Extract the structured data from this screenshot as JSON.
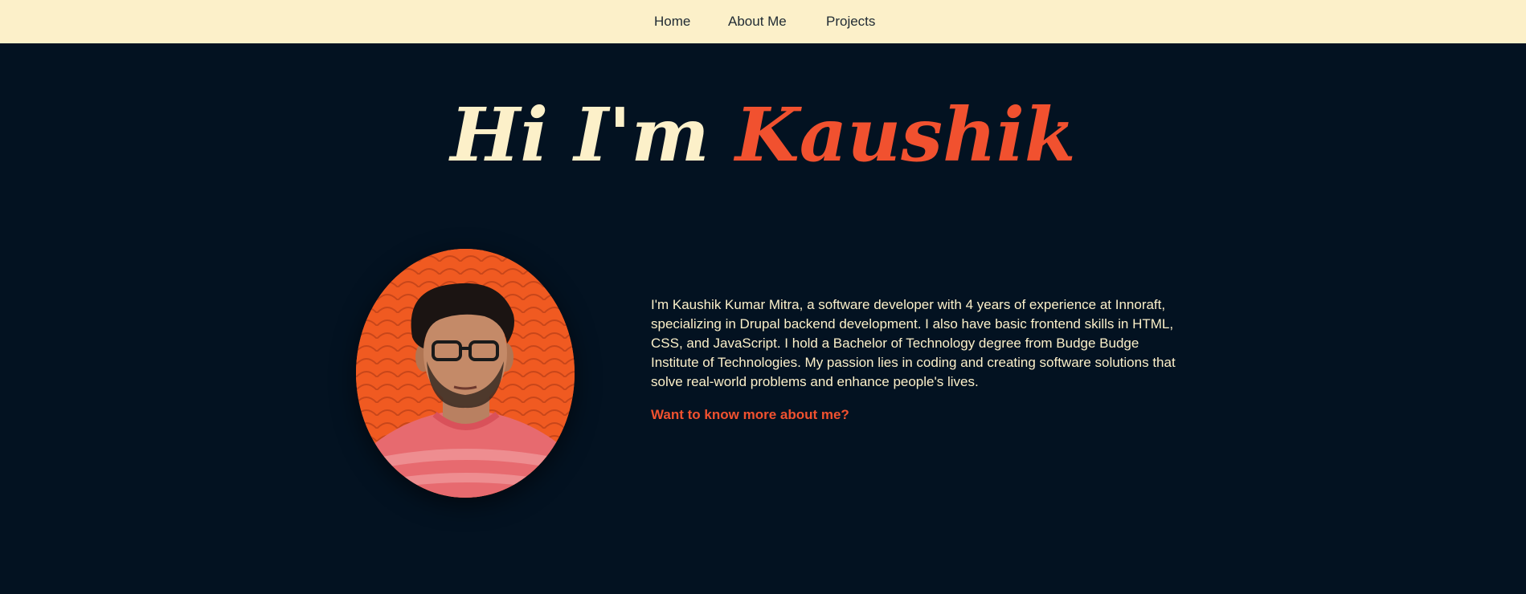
{
  "nav": {
    "items": [
      {
        "label": "Home"
      },
      {
        "label": "About Me"
      },
      {
        "label": "Projects"
      }
    ]
  },
  "hero": {
    "greeting": "Hi I'm",
    "name": "Kaushik"
  },
  "about": {
    "description": "I'm Kaushik Kumar Mitra, a software developer with 4 years of experience at Innoraft, specializing in Drupal backend development. I also have basic frontend skills in HTML, CSS, and JavaScript. I hold a Bachelor of Technology degree from Budge Budge Institute of Technologies. My passion lies in coding and creating software solutions that solve real-world problems and enhance people's lives.",
    "cta": "Want to know more about me?"
  },
  "colors": {
    "nav_bg": "#fcf0c9",
    "page_bg": "#031221",
    "accent": "#f1512f",
    "text_light": "#fcf0c9"
  }
}
